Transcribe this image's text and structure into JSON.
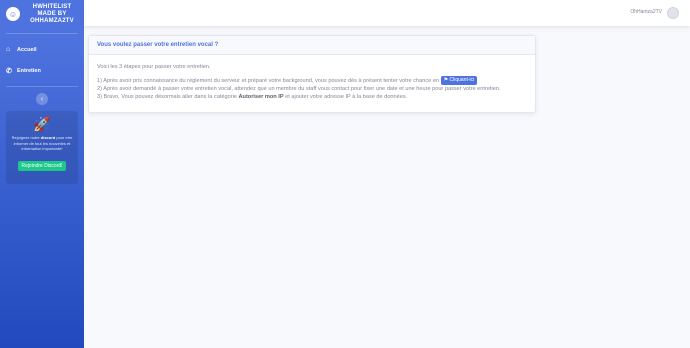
{
  "brand": {
    "line1": "HWHITELIST",
    "line2": "MADE BY",
    "line3": "OHHAMZA2TV",
    "logo_icon": "laugh-icon"
  },
  "nav": {
    "items": [
      {
        "label": "Accueil",
        "icon": "home-icon"
      },
      {
        "label": "Entretien",
        "icon": "phone-icon"
      }
    ]
  },
  "sidebar_toggle": {
    "glyph": "‹"
  },
  "promo": {
    "text_before": "Rejoignez notre ",
    "text_bold": "discord",
    "text_after": " pour etre informer de tout les nouvelles et information importante!",
    "button_label": "Rejoindre Discord!"
  },
  "topbar": {
    "username": "OhHamza2TV"
  },
  "card": {
    "title": "Vous voulez passer votre entretien vocal ?",
    "intro": "Voici les 3 étapes pour passer votre entretien.",
    "step1": "1) Après avoir pris connaissance du réglement du serveur et préparé votre background, vous pouvez dès à présent tenter votre chance en",
    "step1_button": "Cliquant-ici",
    "step2": "2) Après avoir demandé à passer votre entretien vocal, attendez que un membre du staff vous contact pour fixer une date et une heure pour passer votre entretien.",
    "step3_before": "3) Bravo, Vous pouvez désormais aller dans la catégorie ",
    "step3_bold": "Autoriser mon IP",
    "step3_after": " et ajouter votre adresse IP à la base de données."
  },
  "colors": {
    "primary": "#4e73df",
    "success": "#1cc88a",
    "text_muted": "#858796"
  }
}
